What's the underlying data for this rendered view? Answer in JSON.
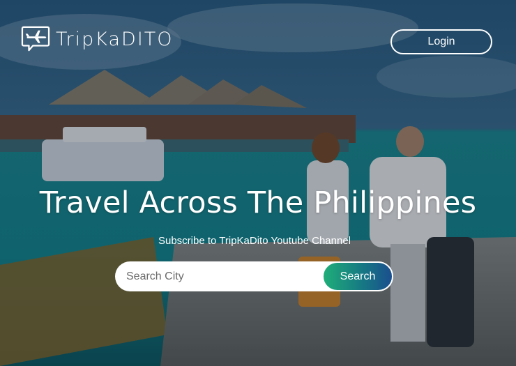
{
  "brand": {
    "name": "TripKaDITO",
    "icon": "airplane-chat-icon"
  },
  "header": {
    "login_label": "Login"
  },
  "hero": {
    "headline": "Travel Across The Philippines",
    "subline": "Subscribe to TripKaDito Youtube Channel"
  },
  "search": {
    "placeholder": "Search City",
    "value": "",
    "button_label": "Search"
  },
  "colors": {
    "search_button_start": "#1fae78",
    "search_button_end": "#1a4f8e",
    "text": "#ffffff"
  }
}
